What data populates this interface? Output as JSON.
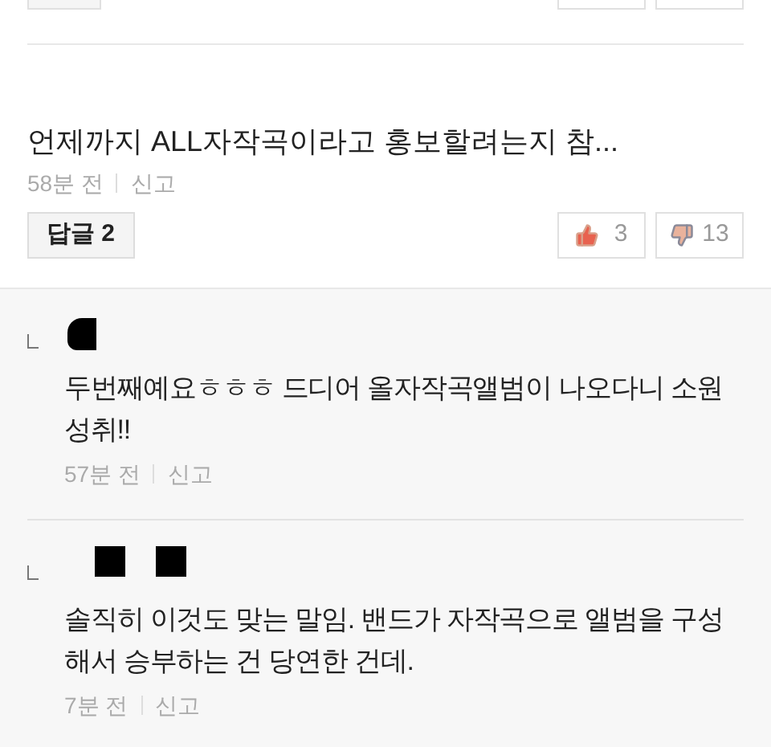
{
  "comment": {
    "text": "언제까지 ALL자작곡이라고 홍보할려는지 참...",
    "time": "58분 전",
    "report": "신고",
    "reply_button": "답글 2",
    "likes": "3",
    "dislikes": "13"
  },
  "replies": [
    {
      "kind": "single",
      "text": "두번째예요ㅎㅎㅎ 드디어 올자작곡앨범이 나오다니 소원성취!!",
      "time": "57분 전",
      "report": "신고"
    },
    {
      "kind": "double",
      "text": "솔직히 이것도 맞는 말임. 밴드가 자작곡으로 앨범을 구성해서 승부하는 건 당연한 건데.",
      "time": "7분 전",
      "report": "신고"
    }
  ]
}
